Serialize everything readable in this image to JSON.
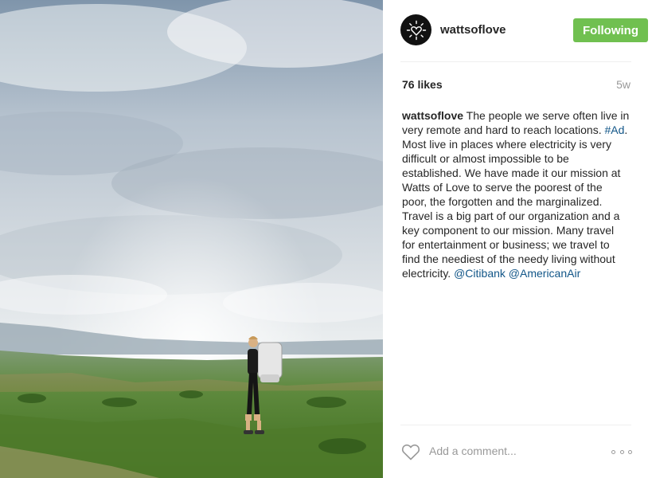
{
  "post": {
    "photo_icon": "landscape-photo",
    "account": {
      "username": "wattsoflove",
      "avatar_icon": "heart-sun-icon",
      "follow_label": "Following"
    },
    "likes": "76 likes",
    "age": "5w",
    "caption": {
      "username": "wattsoflove",
      "text_1": " The people we serve often live in very remote and hard to reach locations. ",
      "hashtag": "#Ad",
      "text_2": ". Most live in places where electricity is very difficult or almost impossible to be established. We have made it our mission at Watts of Love to serve the poorest of the poor, the forgotten and the marginalized. Travel is a big part of our organization and a key component to our mission. Many travel for entertainment or business; we travel to find the neediest of the needy living without electricity. ",
      "mention_1": "@Citibank",
      "mention_2": "@AmericanAir"
    },
    "comment": {
      "placeholder": "Add a comment...",
      "like_icon": "heart-outline-icon",
      "more_icon": "more-options-icon"
    }
  },
  "colors": {
    "follow_button": "#70c050",
    "link": "#125688",
    "text": "#262626",
    "muted": "#999999"
  }
}
